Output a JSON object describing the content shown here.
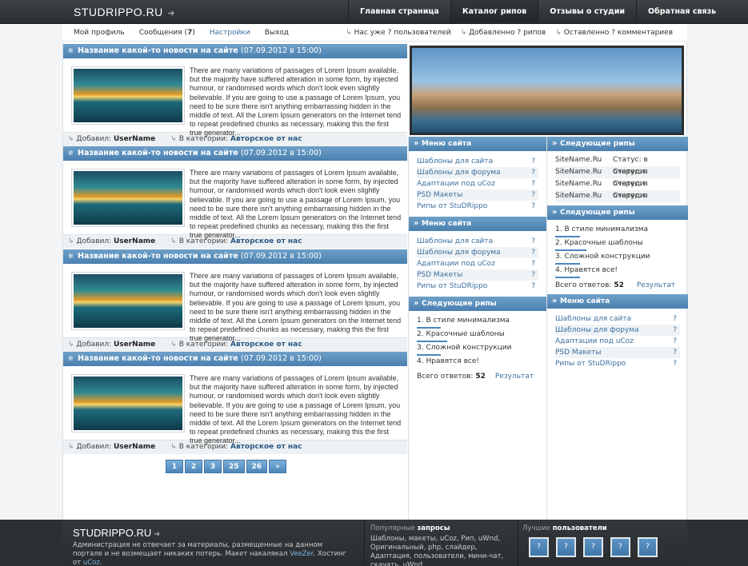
{
  "header": {
    "logo": "STUDRIPPO.RU",
    "nav": [
      "Главная страница",
      "Каталог рипов",
      "Отзывы о студии",
      "Обратная связь"
    ]
  },
  "subnav": {
    "left": [
      {
        "label": "Мой профиль"
      },
      {
        "label": "Сообщения (",
        "count": "7",
        "suffix": ")"
      },
      {
        "label": "Настройки"
      },
      {
        "label": "Выход"
      }
    ],
    "right": [
      "Нас уже ? пользователей",
      "Добавленно ? рипов",
      "Оставленно ? комментариев"
    ]
  },
  "posts": [
    {
      "title": "Название какой-то новости на сайте",
      "date": "(07.09.2012 в 15:00)",
      "text": "There are many variations of passages of Lorem Ipsum available, but the majority have suffered alteration in some form, by injected humour, or randomised words which don't look even slightly believable. If you are going to use a passage of Lorem Ipsum, you need to be sure there isn't anything embarrassing hidden in the middle of text. All the Lorem Ipsum generators on the Internet tend to repeat predefined chunks as necessary, making this the first true generator...",
      "added_label": "Добавил:",
      "author": "UserName",
      "cat_label": "В категории:",
      "category": "Авторское от нас"
    },
    {
      "title": "Название какой-то новости на сайте",
      "date": "(07.09.2012 в 15:00)",
      "text": "There are many variations of passages of Lorem Ipsum available, but the majority have suffered alteration in some form, by injected humour, or randomised words which don't look even slightly believable. If you are going to use a passage of Lorem Ipsum, you need to be sure there isn't anything embarrassing hidden in the middle of text. All the Lorem Ipsum generators on the Internet tend to repeat predefined chunks as necessary, making this the first true generator...",
      "added_label": "Добавил:",
      "author": "UserName",
      "cat_label": "В категории:",
      "category": "Авторское от нас"
    },
    {
      "title": "Название какой-то новости на сайте",
      "date": "(07.09.2012 в 15:00)",
      "text": "There are many variations of passages of Lorem Ipsum available, but the majority have suffered alteration in some form, by injected humour, or randomised words which don't look even slightly believable. If you are going to use a passage of Lorem Ipsum, you need to be sure there isn't anything embarrassing hidden in the middle of text. All the Lorem Ipsum generators on the Internet tend to repeat predefined chunks as necessary, making this the first true generator...",
      "added_label": "Добавил:",
      "author": "UserName",
      "cat_label": "В категории:",
      "category": "Авторское от нас"
    },
    {
      "title": "Название какой-то новости на сайте",
      "date": "(07.09.2012 в 15:00)",
      "text": "There are many variations of passages of Lorem Ipsum available, but the majority have suffered alteration in some form, by injected humour, or randomised words which don't look even slightly believable. If you are going to use a passage of Lorem Ipsum, you need to be sure there isn't anything embarrassing hidden in the middle of text. All the Lorem Ipsum generators on the Internet tend to repeat predefined chunks as necessary, making this the first true generator...",
      "added_label": "Добавил:",
      "author": "UserName",
      "cat_label": "В категории:",
      "category": "Авторское от нас"
    }
  ],
  "pager": [
    "1",
    "2",
    "3",
    "25",
    "26",
    "»"
  ],
  "site_menu": {
    "title": "Меню сайта",
    "items": [
      "Шаблоны для сайта",
      "Шаблоны для форума",
      "Адаптации под uCoz",
      "PSD Макеты",
      "Рипы от StuDRippo"
    ],
    "mark": "?"
  },
  "next_rips_poll": {
    "title": "Следующие рипы",
    "options": [
      {
        "label": "1. В стиле минимализма",
        "share": 0.2
      },
      {
        "label": "2. Красочные шаблоны",
        "share": 0.25
      },
      {
        "label": "3. Сложной конструкции",
        "share": 0.2
      },
      {
        "label": "4. Нравятся все!",
        "share": 0.2
      }
    ],
    "total_label": "Всего ответов:",
    "total": "52",
    "result_label": "Результат"
  },
  "next_rips_list": {
    "title": "Следующие рипы",
    "rows": [
      {
        "site": "SiteName.Ru",
        "status": "Статус: в очереди"
      },
      {
        "site": "SiteName.Ru",
        "status": "Статус: в очереди"
      },
      {
        "site": "SiteName.Ru",
        "status": "Статус: в очереди"
      },
      {
        "site": "SiteName.Ru",
        "status": "Статус: в очереди"
      }
    ]
  },
  "footer": {
    "logo": "STUDRIPPO.RU",
    "text_1": "Администрация не отвечает за материалы, размещенные на данном портале и не возмещает никаких потерь. Макет накалякал ",
    "veezer": "VeeZer",
    "text_2": ". Хостинг от ",
    "ucoz": "uCoz",
    "text_3": ".",
    "popular_title_a": "Популярные",
    "popular_title_b": "запросы",
    "popular_text": "Шаблоны, макеты, uCoz, Рип, uWnd, Оригинальный, php, слайдер, Адаптация, пользователи, мини-чат, скачать, uWnd",
    "best_title_a": "Лучшие",
    "best_title_b": "пользователи",
    "avatar_mark": "?"
  }
}
